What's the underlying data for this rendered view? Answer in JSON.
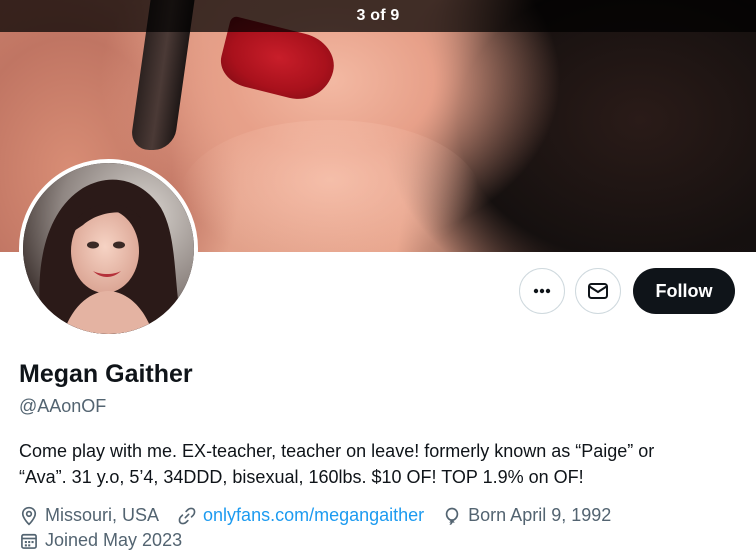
{
  "gallery": {
    "counter": "3 of 9"
  },
  "profile": {
    "name": "Megan Gaither",
    "handle": "@AAonOF",
    "bio_line1": "Come play with me. EX-teacher, teacher on leave! formerly known as “Paige” or",
    "bio_line2": "“Ava”. 31 y.o, 5’4, 34DDD, bisexual, 160lbs. $10 OF!  TOP 1.9% on OF!",
    "location": "Missouri, USA",
    "website": "onlyfans.com/megangaither",
    "birthday": "Born April 9, 1992",
    "joined": "Joined May 2023"
  },
  "actions": {
    "more_icon": "more-horizontal-icon",
    "message_icon": "envelope-icon",
    "follow_label": "Follow"
  },
  "colors": {
    "text_primary": "#0f1419",
    "text_secondary": "#536471",
    "link": "#1d9bf0",
    "follow_bg": "#0f1419"
  }
}
